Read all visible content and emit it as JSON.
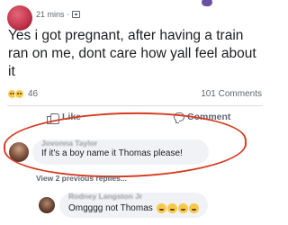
{
  "post": {
    "meta": {
      "time": "21 mins ·"
    },
    "text": "Yes i got pregnant, after having a train ran on me, dont care how yall feel about it",
    "reactions": {
      "count": "46"
    },
    "comments_count": "101 Comments"
  },
  "actions": {
    "like_label": "Like",
    "comment_label": "Comment"
  },
  "comments": [
    {
      "author": "Jovonna Taylor",
      "text": "If it's a boy name it Thomas please!"
    }
  ],
  "view_replies": "View 2 previous replies...",
  "reply": {
    "author": "Rodney Langston Jr",
    "text": "Omgggg not Thomas"
  },
  "colors": {
    "annotation": "#d63c24",
    "bubble": "#f0f2f5",
    "meta_text": "#606770"
  }
}
